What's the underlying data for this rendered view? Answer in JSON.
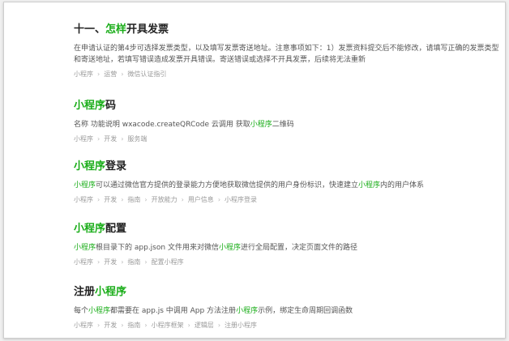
{
  "results": [
    {
      "title": [
        {
          "text": "十一、",
          "hl": false
        },
        {
          "text": "怎样",
          "hl": true
        },
        {
          "text": "开具发票",
          "hl": false
        }
      ],
      "desc": [
        {
          "text": "在申请认证的第4步可选择发票类型，以及填写发票寄送地址。注意事项如下：1）发票资料提交后不能修改，请填写正确的发票类型和寄送地址，若填写错误造成发票开具错误。寄送错误或选择不开具发票，后续将无法重新",
          "hl": false
        }
      ],
      "crumbs": [
        "小程序",
        "运营",
        "微信认证指引"
      ]
    },
    {
      "title": [
        {
          "text": "小程序",
          "hl": true
        },
        {
          "text": "码",
          "hl": false
        }
      ],
      "desc": [
        {
          "text": "名称 功能说明 wxacode.createQRCode 云调用 获取",
          "hl": false
        },
        {
          "text": "小程序",
          "hl": true
        },
        {
          "text": "二维码",
          "hl": false
        }
      ],
      "crumbs": [
        "小程序",
        "开发",
        "服务端"
      ]
    },
    {
      "title": [
        {
          "text": "小程序",
          "hl": true
        },
        {
          "text": "登录",
          "hl": false
        }
      ],
      "desc": [
        {
          "text": "小程序",
          "hl": true
        },
        {
          "text": "可以通过微信官方提供的登录能力方便地获取微信提供的用户身份标识，快速建立",
          "hl": false
        },
        {
          "text": "小程序",
          "hl": true
        },
        {
          "text": "内的用户体系",
          "hl": false
        }
      ],
      "crumbs": [
        "小程序",
        "开发",
        "指南",
        "开放能力",
        "用户信息",
        "小程序登录"
      ]
    },
    {
      "title": [
        {
          "text": "小程序",
          "hl": true
        },
        {
          "text": "配置",
          "hl": false
        }
      ],
      "desc": [
        {
          "text": "小程序",
          "hl": true
        },
        {
          "text": "根目录下的 app.json 文件用来对微信",
          "hl": false
        },
        {
          "text": "小程序",
          "hl": true
        },
        {
          "text": "进行全局配置，决定页面文件的路径",
          "hl": false
        }
      ],
      "crumbs": [
        "小程序",
        "开发",
        "指南",
        "配置小程序"
      ]
    },
    {
      "title": [
        {
          "text": "注册",
          "hl": false
        },
        {
          "text": "小程序",
          "hl": true
        }
      ],
      "desc": [
        {
          "text": "每个",
          "hl": false
        },
        {
          "text": "小程序",
          "hl": true
        },
        {
          "text": "都需要在 app.js 中调用 App 方法注册",
          "hl": false
        },
        {
          "text": "小程序",
          "hl": true
        },
        {
          "text": "示例，绑定生命周期回调函数",
          "hl": false
        }
      ],
      "crumbs": [
        "小程序",
        "开发",
        "指南",
        "小程序框架",
        "逻辑层",
        "注册小程序"
      ]
    }
  ],
  "colors": {
    "highlight": "#1aad19"
  },
  "icons": {
    "crumb_separator": "chevron-right-icon"
  }
}
